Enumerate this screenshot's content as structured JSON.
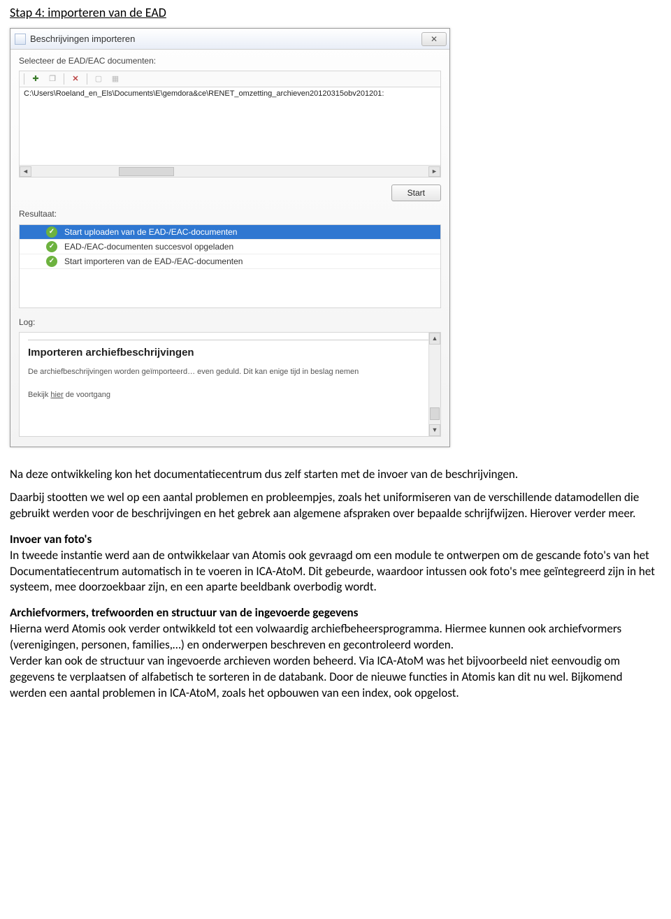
{
  "step_title": "Stap 4: importeren van de EAD",
  "dialog": {
    "title": "Beschrijvingen importeren",
    "select_label": "Selecteer de EAD/EAC documenten:",
    "file_path": "C:\\Users\\Roeland_en_Els\\Documents\\E\\gemdora&ce\\RENET_omzetting_archieven20120315obv201201:",
    "start_button": "Start",
    "result_label": "Resultaat:",
    "results": [
      "Start uploaden van de EAD-/EAC-documenten",
      "EAD-/EAC-documenten succesvol opgeladen",
      "Start importeren van de EAD-/EAC-documenten"
    ],
    "log_label": "Log:",
    "log_heading": "Importeren archiefbeschrijvingen",
    "log_text": "De archiefbeschrijvingen worden geïmporteerd… even geduld. Dit kan enige tijd in beslag nemen",
    "log_footer_prefix": "Bekijk ",
    "log_footer_link": "hier",
    "log_footer_suffix": " de voortgang"
  },
  "body": {
    "p1": "Na deze ontwikkeling kon het documentatiecentrum dus zelf starten met de invoer van de beschrijvingen.",
    "p2": "Daarbij stootten we wel op een aantal problemen en probleempjes, zoals het uniformiseren van de verschillende datamodellen die gebruikt werden voor de beschrijvingen en het gebrek aan algemene afspraken over bepaalde schrijfwijzen. Hierover verder meer.",
    "h1": "Invoer van foto's",
    "p3": "In tweede instantie werd aan de ontwikkelaar van Atomis ook gevraagd om een module te ontwerpen om de gescande foto's van het Documentatiecentrum automatisch in te voeren in ICA-AtoM. Dit gebeurde, waardoor intussen ook foto's mee geïntegreerd zijn in het systeem, mee doorzoekbaar zijn, en een aparte beeldbank overbodig wordt.",
    "h2": "Archiefvormers, trefwoorden en structuur van de ingevoerde gegevens",
    "p4": "Hierna werd Atomis ook verder ontwikkeld tot een volwaardig archiefbeheersprogramma. Hiermee kunnen ook archiefvormers (verenigingen, personen, families,…) en onderwerpen beschreven en gecontroleerd worden.",
    "p5": "Verder kan ook de structuur van ingevoerde archieven worden beheerd. Via ICA-AtoM was het bijvoorbeeld niet eenvoudig om gegevens te verplaatsen of alfabetisch te sorteren in de databank. Door de nieuwe functies in Atomis kan dit nu wel. Bijkomend werden een aantal problemen in ICA-AtoM, zoals het opbouwen van een index, ook opgelost."
  }
}
